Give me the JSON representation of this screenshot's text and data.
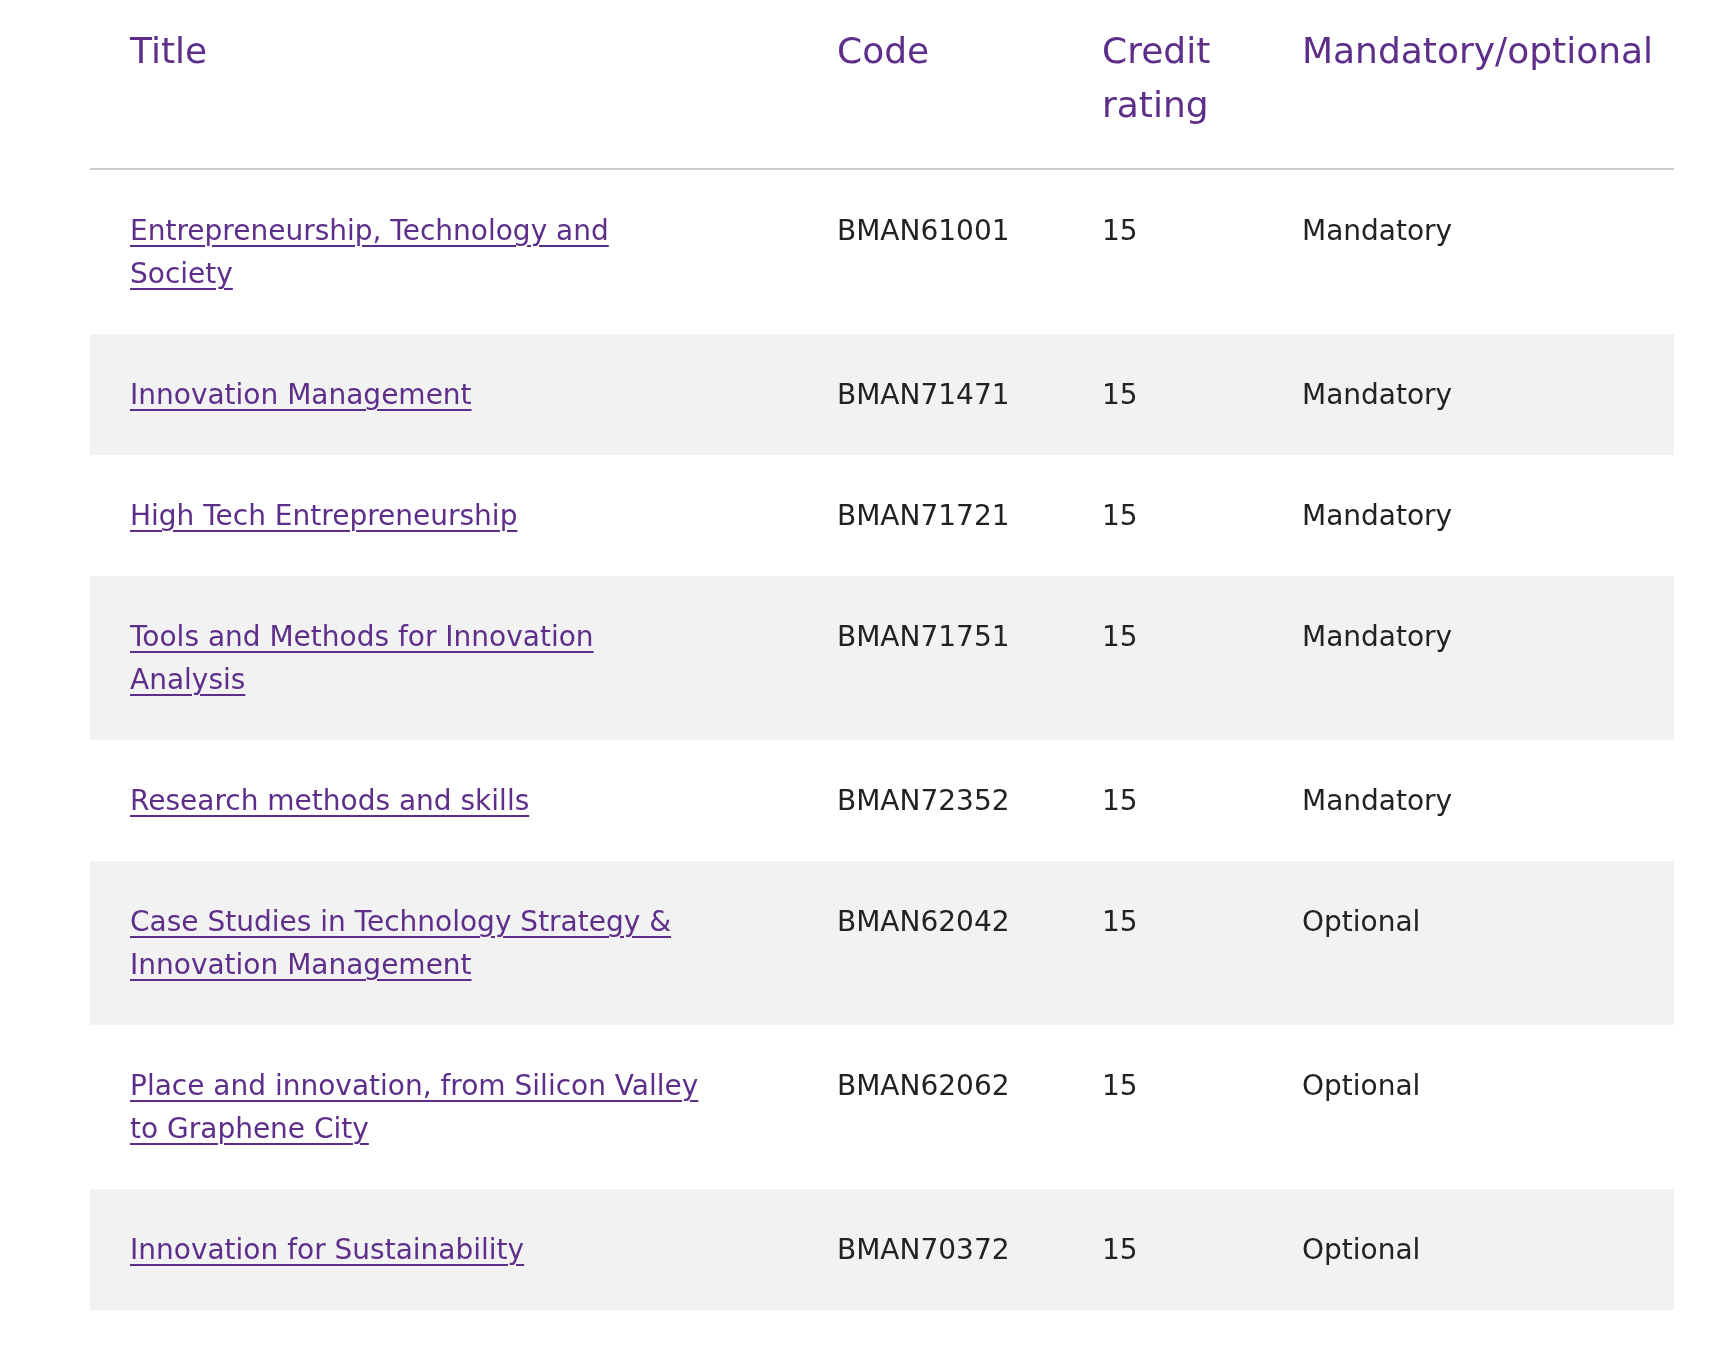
{
  "table": {
    "columns": [
      "Title",
      "Code",
      "Credit rating",
      "Mandatory/optional"
    ],
    "rows": [
      {
        "title": "Entrepreneurship, Technology and Society",
        "code": "BMAN61001",
        "credit": "15",
        "status": "Mandatory"
      },
      {
        "title": "Innovation Management",
        "code": "BMAN71471",
        "credit": "15",
        "status": "Mandatory"
      },
      {
        "title": "High Tech Entrepreneurship",
        "code": "BMAN71721",
        "credit": "15",
        "status": "Mandatory"
      },
      {
        "title": "Tools and Methods for Innovation Analysis",
        "code": "BMAN71751",
        "credit": "15",
        "status": "Mandatory"
      },
      {
        "title": "Research methods and skills",
        "code": "BMAN72352",
        "credit": "15",
        "status": "Mandatory"
      },
      {
        "title": "Case Studies in Technology Strategy & Innovation Management",
        "code": "BMAN62042",
        "credit": "15",
        "status": "Optional"
      },
      {
        "title": "Place and innovation, from Silicon Valley to Graphene City",
        "code": "BMAN62062",
        "credit": "15",
        "status": "Optional"
      },
      {
        "title": "Innovation for Sustainability",
        "code": "BMAN70372",
        "credit": "15",
        "status": "Optional"
      }
    ]
  }
}
